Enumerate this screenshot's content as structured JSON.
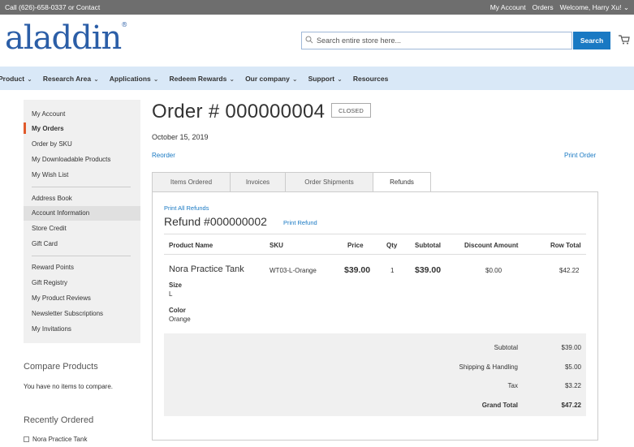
{
  "topbar": {
    "call": "Call (626)-658-0337",
    "or": "or",
    "contact": "Contact",
    "my_account": "My Account",
    "orders": "Orders",
    "welcome": "Welcome, Harry Xu!"
  },
  "header": {
    "logo_text": "aladdin",
    "search_placeholder": "Search entire store here...",
    "search_button": "Search"
  },
  "nav": {
    "items": [
      {
        "label": "Product"
      },
      {
        "label": "Research Area"
      },
      {
        "label": "Applications"
      },
      {
        "label": "Redeem Rewards"
      },
      {
        "label": "Our company"
      },
      {
        "label": "Support"
      },
      {
        "label": "Resources"
      }
    ]
  },
  "sidebar": {
    "items": [
      "My Account",
      "My Orders",
      "Order by SKU",
      "My Downloadable Products",
      "My Wish List",
      "Address Book",
      "Account Information",
      "Store Credit",
      "Gift Card",
      "Reward Points",
      "Gift Registry",
      "My Product Reviews",
      "Newsletter Subscriptions",
      "My Invitations"
    ],
    "active": "My Orders",
    "compare_title": "Compare Products",
    "compare_text": "You have no items to compare.",
    "recent_title": "Recently Ordered",
    "recent_item": "Nora Practice Tank"
  },
  "order": {
    "title": "Order # 000000004",
    "status": "CLOSED",
    "date": "October 15, 2019",
    "reorder": "Reorder",
    "print_order": "Print Order",
    "tabs": [
      "Items Ordered",
      "Invoices",
      "Order Shipments",
      "Refunds"
    ],
    "active_tab": "Refunds"
  },
  "refund": {
    "print_all": "Print All Refunds",
    "title": "Refund #000000002",
    "print_refund": "Print Refund",
    "columns": [
      "Product Name",
      "SKU",
      "Price",
      "Qty",
      "Subtotal",
      "Discount Amount",
      "Row Total"
    ],
    "item": {
      "name": "Nora Practice Tank",
      "sku": "WT03-L-Orange",
      "price": "$39.00",
      "qty": "1",
      "subtotal": "$39.00",
      "discount": "$0.00",
      "row_total": "$42.22",
      "size_label": "Size",
      "size_value": "L",
      "color_label": "Color",
      "color_value": "Orange"
    },
    "totals": [
      {
        "label": "Subtotal",
        "value": "$39.00"
      },
      {
        "label": "Shipping & Handling",
        "value": "$5.00"
      },
      {
        "label": "Tax",
        "value": "$3.22"
      },
      {
        "label": "Grand Total",
        "value": "$47.22"
      }
    ]
  },
  "colors": {
    "accent_blue": "#1979c3",
    "nav_bg": "#d9e8f7",
    "active_marker": "#e05a2b",
    "topbar_bg": "#6e6e6e"
  }
}
